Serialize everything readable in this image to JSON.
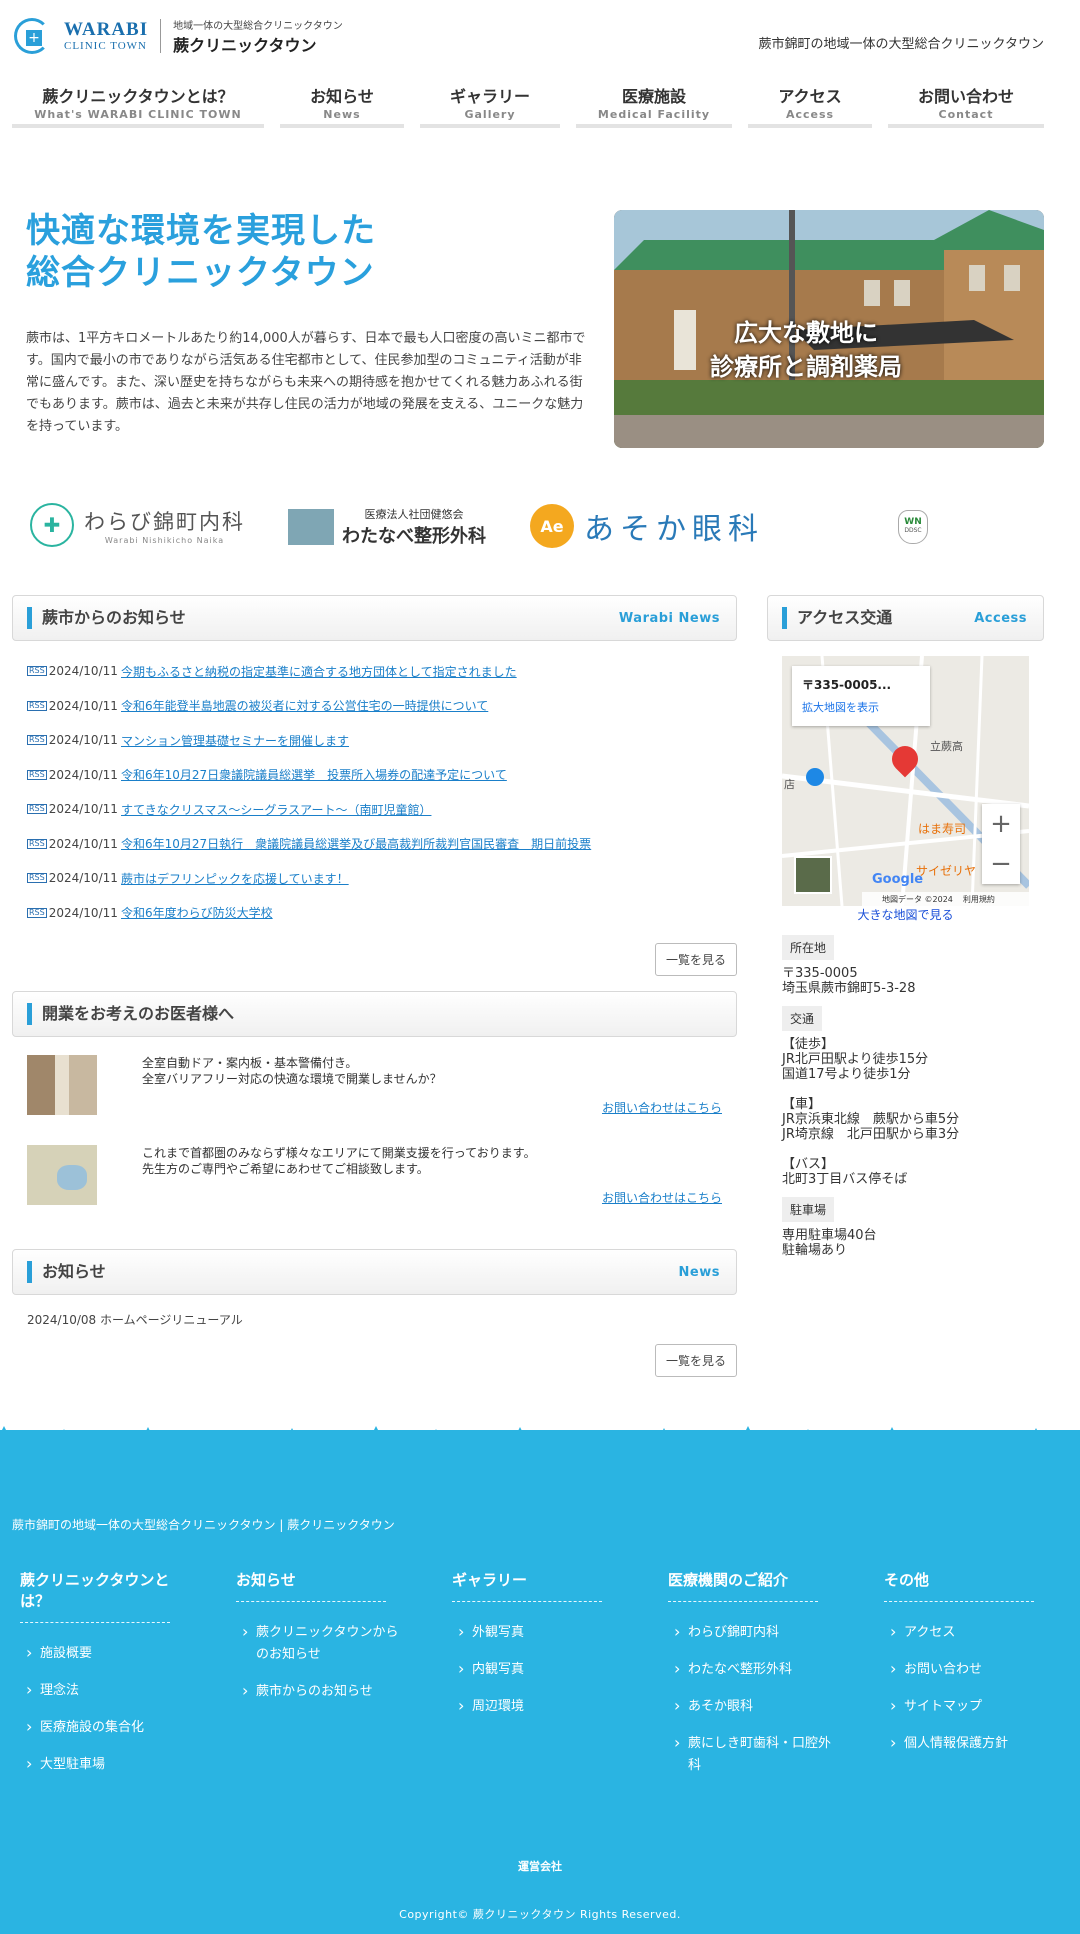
{
  "header": {
    "logo_en_1": "WARABI",
    "logo_en_2": "CLINIC TOWN",
    "logo_jp_small": "地域一体の大型総合クリニックタウン",
    "logo_jp_name": "蕨クリニックタウン",
    "tagline": "蕨市錦町の地域一体の大型総合クリニックタウン"
  },
  "nav": [
    {
      "label": "蕨クリニックタウンとは？",
      "sub": "What's WARABI CLINIC TOWN"
    },
    {
      "label": "お知らせ",
      "sub": "News"
    },
    {
      "label": "ギャラリー",
      "sub": "Gallery"
    },
    {
      "label": "医療施設",
      "sub": "Medical Facility"
    },
    {
      "label": "アクセス",
      "sub": "Access"
    },
    {
      "label": "お問い合わせ",
      "sub": "Contact"
    }
  ],
  "hero": {
    "title_1": "快適な環境を実現した",
    "title_2": "総合クリニックタウン",
    "text": "蕨市は、1平方キロメートルあたり約14,000人が暮らす、日本で最も人口密度の高いミニ都市です。国内で最小の市でありながら活気ある住宅都市として、住民参加型のコミュニティ活動が非常に盛んです。また、深い歴史を持ちながらも未来への期待感を抱かせてくれる魅力あふれる街でもあります。蕨市は、過去と未来が共存し住民の活力が地域の発展を支える、ユニークな魅力を持っています。",
    "image_caption_1": "広大な敷地に",
    "image_caption_2": "診療所と調剤薬局"
  },
  "clinics": {
    "c1_name": "わらび錦町内科",
    "c1_sub": "Warabi Nishikicho Naika",
    "c2_small": "医療法人社団健悠会",
    "c2_name": "わたなべ整形外科",
    "c3_mark": "Ae",
    "c3_name": "あそか眼科",
    "c4_mark": "WN",
    "c4_sub": "DDSC"
  },
  "city_news": {
    "title": "蕨市からのお知らせ",
    "title_en": "Warabi News",
    "icon": "RSS",
    "items": [
      {
        "date": "2024/10/11",
        "text": "今期もふるさと納税の指定基準に適合する地方団体として指定されました"
      },
      {
        "date": "2024/10/11",
        "text": "令和6年能登半島地震の被災者に対する公営住宅の一時提供について"
      },
      {
        "date": "2024/10/11",
        "text": "マンション管理基礎セミナーを開催します"
      },
      {
        "date": "2024/10/11",
        "text": "令和6年10月27日衆議院議員総選挙　投票所入場券の配達予定について"
      },
      {
        "date": "2024/10/11",
        "text": "すてきなクリスマス～シーグラスアート～（南町児童館）"
      },
      {
        "date": "2024/10/11",
        "text": "令和6年10月27日執行　衆議院議員総選挙及び最高裁判所裁判官国民審査　期日前投票"
      },
      {
        "date": "2024/10/11",
        "text": "蕨市はデフリンピックを応援しています！"
      },
      {
        "date": "2024/10/11",
        "text": "令和6年度わらび防災大学校"
      }
    ],
    "more": "一覧を見る"
  },
  "doctors": {
    "title": "開業をお考えのお医者様へ",
    "items": [
      {
        "line1": "全室自動ドア・案内板・基本警備付き。",
        "line2": "全室バリアフリー対応の快適な環境で開業しませんか？",
        "link": "お問い合わせはこちら"
      },
      {
        "line1": "これまで首都圏のみならず様々なエリアにて開業支援を行っております。",
        "line2": "先生方のご専門やご希望にあわせてご相談致します。",
        "link": "お問い合わせはこちら"
      }
    ]
  },
  "notices": {
    "title": "お知らせ",
    "title_en": "News",
    "item": "2024/10/08 ホームページリニューアル",
    "more": "一覧を見る"
  },
  "access": {
    "title": "アクセス交通",
    "title_en": "Access",
    "map_postal": "〒335-0005...",
    "map_enlarge": "拡大地図を表示",
    "map_label_1": "はま寿司",
    "map_label_2": "サイゼリヤ",
    "map_label_3": "立蕨高",
    "map_label_4": "店",
    "map_google": "Google",
    "map_data": "地図データ ©2024",
    "map_terms": "利用規約",
    "map_zoom_in": "+",
    "map_zoom_out": "−",
    "map_big_link": "大きな地図で見る",
    "loc_tag": "所在地",
    "loc_1": "〒335-0005",
    "loc_2": "埼玉県蕨市錦町5-3-28",
    "traffic_tag": "交通",
    "walk_h": "【徒歩】",
    "walk_1": "JR北戸田駅より徒歩15分",
    "walk_2": "国道17号より徒歩1分",
    "car_h": "【車】",
    "car_1": "JR京浜東北線　蕨駅から車5分",
    "car_2": "JR埼京線　北戸田駅から車3分",
    "bus_h": "【バス】",
    "bus_1": "北町3丁目バス停そば",
    "parking_tag": "駐車場",
    "park_1": "専用駐車場40台",
    "park_2": "駐輪場あり"
  },
  "footer": {
    "tagline": "蕨市錦町の地域一体の大型総合クリニックタウン | 蕨クリニックタウン",
    "cols": [
      {
        "head": "蕨クリニックタウンとは？",
        "items": [
          "施設概要",
          "理念法",
          "医療施設の集合化",
          "大型駐車場"
        ]
      },
      {
        "head": "お知らせ",
        "items": [
          "蕨クリニックタウンからのお知らせ",
          "蕨市からのお知らせ"
        ]
      },
      {
        "head": "ギャラリー",
        "items": [
          "外観写真",
          "内観写真",
          "周辺環境"
        ]
      },
      {
        "head": "医療機関のご紹介",
        "items": [
          "わらび錦町内科",
          "わたなべ整形外科",
          "あそか眼科",
          "蕨にしき町歯科・口腔外科"
        ]
      },
      {
        "head": "その他",
        "items": [
          "アクセス",
          "お問い合わせ",
          "サイトマップ",
          "個人情報保護方針"
        ]
      }
    ],
    "operator": "運営会社",
    "copyright": "Copyright© 蕨クリニックタウン Rights Reserved."
  },
  "colors": {
    "accent": "#2a9fd8",
    "footer_bg": "#2ab4e2"
  }
}
